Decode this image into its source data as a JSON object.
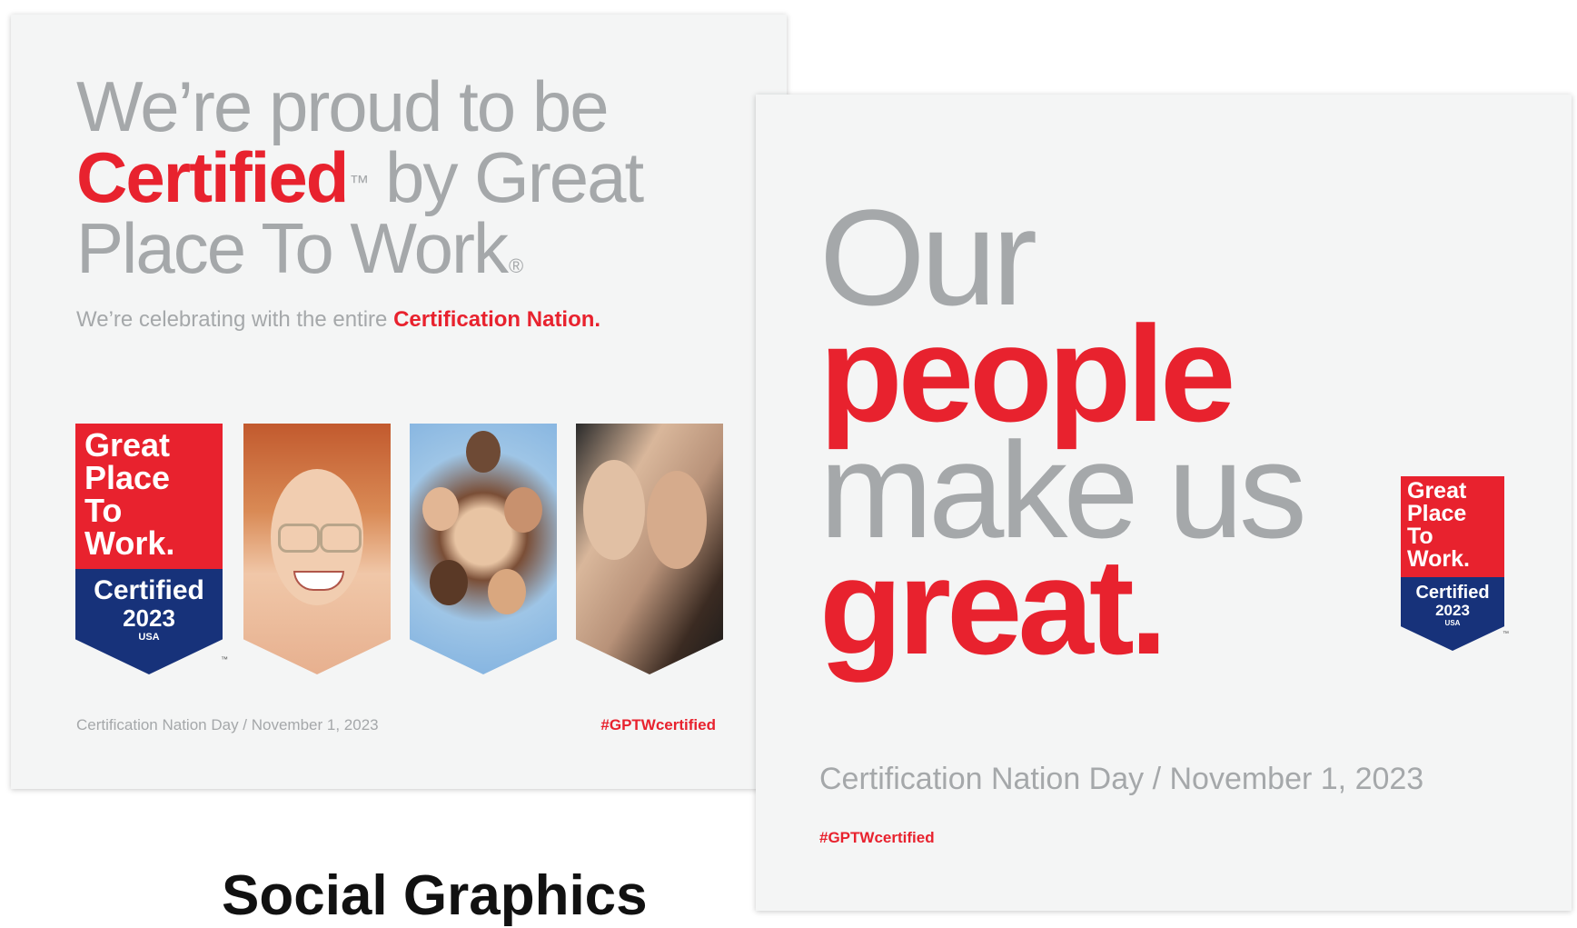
{
  "left_card": {
    "line1": "We’re proud to be",
    "certified": "Certified",
    "tm": "™",
    "by_great": " by Great",
    "line3": "Place To Work",
    "reg": "®",
    "subline_gray": "We’re celebrating with the entire ",
    "subline_red": "Certification Nation.",
    "badge": {
      "line1": "Great",
      "line2": "Place",
      "line3": "To",
      "line4": "Work.",
      "certified": "Certified",
      "year": "2023",
      "country": "USA",
      "tm": "™"
    },
    "footer": "Certification Nation Day / November 1, 2023",
    "hashtag": "#GPTWcertified"
  },
  "right_card": {
    "line1": "Our",
    "line2": "people",
    "line3": "make us",
    "line4": "great.",
    "badge": {
      "line1": "Great",
      "line2": "Place",
      "line3": "To",
      "line4": "Work.",
      "certified": "Certified",
      "year": "2023",
      "country": "USA",
      "tm": "™"
    },
    "footer": "Certification Nation Day / November 1, 2023",
    "hashtag": "#GPTWcertified"
  },
  "caption": "Social Graphics",
  "colors": {
    "red": "#e8222e",
    "navy": "#17327a",
    "gray_text": "#a5a8aa",
    "card_bg": "#f4f5f5"
  }
}
